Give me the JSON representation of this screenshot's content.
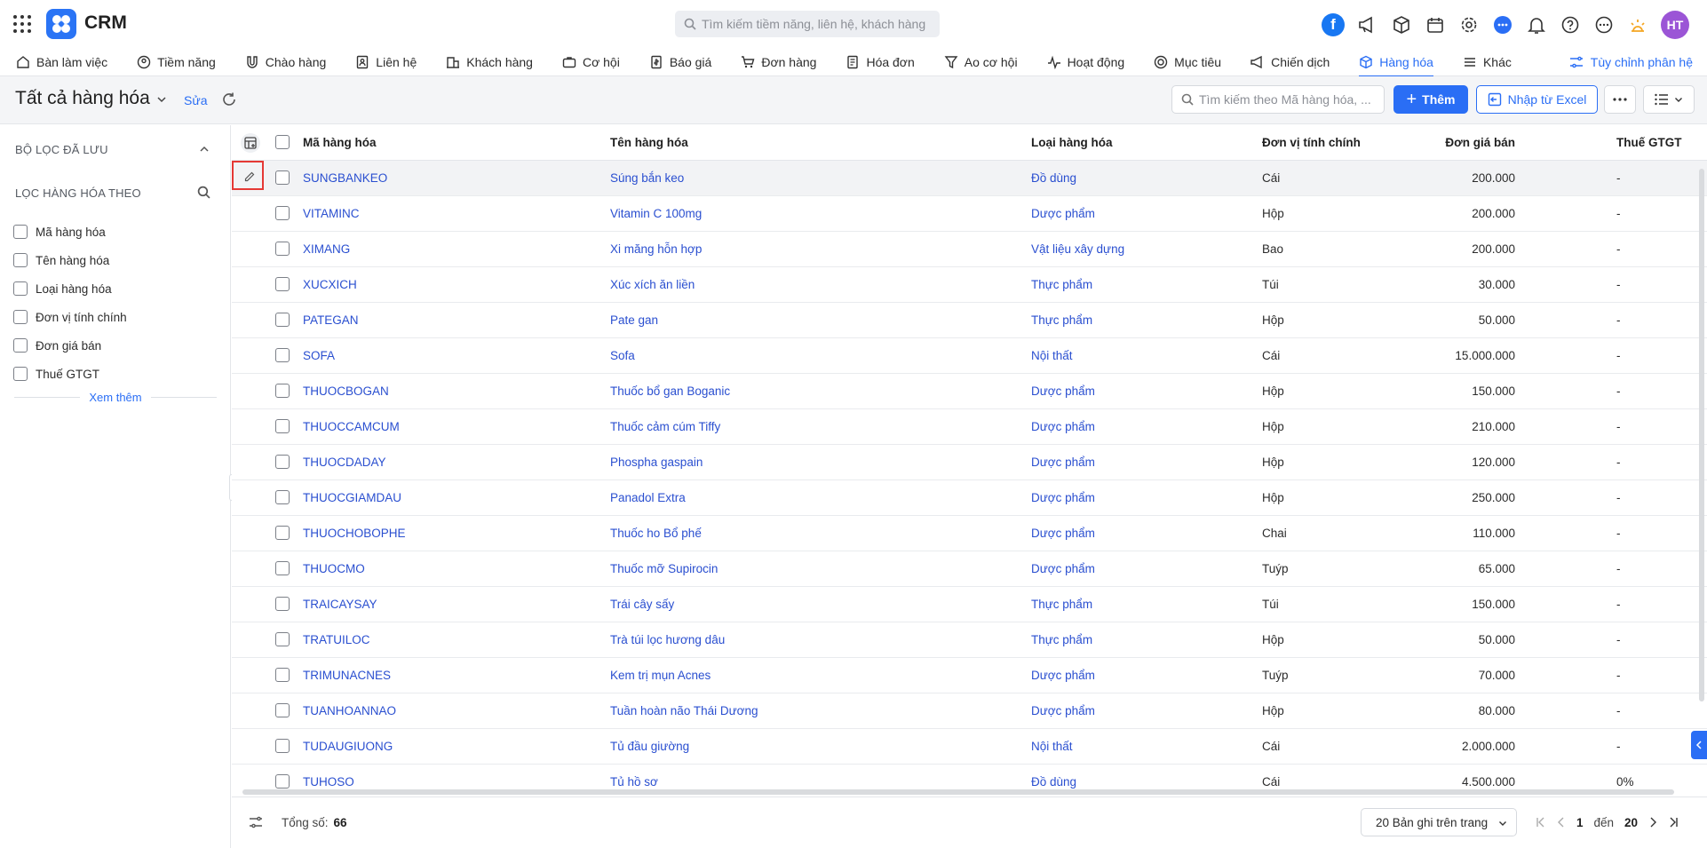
{
  "app": {
    "name": "CRM",
    "search_placeholder": "Tìm kiếm tiềm năng, liên hệ, khách hàng",
    "avatar_initials": "HT",
    "facebook_letter": "f"
  },
  "nav": {
    "items": [
      {
        "label": "Bàn làm việc",
        "icon": "home-icon"
      },
      {
        "label": "Tiềm năng",
        "icon": "user-circle-icon"
      },
      {
        "label": "Chào hàng",
        "icon": "magnet-icon"
      },
      {
        "label": "Liên hệ",
        "icon": "contact-icon"
      },
      {
        "label": "Khách hàng",
        "icon": "building-icon"
      },
      {
        "label": "Cơ hội",
        "icon": "briefcase-icon"
      },
      {
        "label": "Báo giá",
        "icon": "document-dollar-icon"
      },
      {
        "label": "Đơn hàng",
        "icon": "cart-icon"
      },
      {
        "label": "Hóa đơn",
        "icon": "invoice-icon"
      },
      {
        "label": "Ao cơ hội",
        "icon": "funnel-icon"
      },
      {
        "label": "Hoạt động",
        "icon": "pulse-icon"
      },
      {
        "label": "Mục tiêu",
        "icon": "target-icon"
      },
      {
        "label": "Chiến dịch",
        "icon": "megaphone-icon"
      },
      {
        "label": "Hàng hóa",
        "icon": "box-icon",
        "active": true
      },
      {
        "label": "Khác",
        "icon": "menu-icon"
      }
    ],
    "customize_label": "Tùy chỉnh phân hệ"
  },
  "toolbar": {
    "title": "Tất cả hàng hóa",
    "edit_label": "Sửa",
    "search_placeholder": "Tìm kiếm theo Mã hàng hóa, ...",
    "add_label": "Thêm",
    "import_label": "Nhập từ Excel"
  },
  "sidebar": {
    "saved_filters_title": "BỘ LỌC ĐÃ LƯU",
    "filter_by_title": "LỌC HÀNG HÓA THEO",
    "filters": [
      "Mã hàng hóa",
      "Tên hàng hóa",
      "Loại hàng hóa",
      "Đơn vị tính chính",
      "Đơn giá bán",
      "Thuế GTGT"
    ],
    "see_more": "Xem thêm"
  },
  "table": {
    "columns": [
      "Mã hàng hóa",
      "Tên hàng hóa",
      "Loại hàng hóa",
      "Đơn vị tính chính",
      "Đơn giá bán",
      "Thuế GTGT"
    ],
    "rows": [
      [
        "SUNGBANKEO",
        "Súng bắn keo",
        "Đồ dùng",
        "Cái",
        "200.000",
        "-"
      ],
      [
        "VITAMINC",
        "Vitamin C 100mg",
        "Dược phẩm",
        "Hộp",
        "200.000",
        "-"
      ],
      [
        "XIMANG",
        "Xi măng hỗn hợp",
        "Vật liệu xây dựng",
        "Bao",
        "200.000",
        "-"
      ],
      [
        "XUCXICH",
        "Xúc xích ăn liền",
        "Thực phẩm",
        "Túi",
        "30.000",
        "-"
      ],
      [
        "PATEGAN",
        "Pate gan",
        "Thực phẩm",
        "Hộp",
        "50.000",
        "-"
      ],
      [
        "SOFA",
        "Sofa",
        "Nội thất",
        "Cái",
        "15.000.000",
        "-"
      ],
      [
        "THUOCBOGAN",
        "Thuốc bổ gan Boganic",
        "Dược phẩm",
        "Hộp",
        "150.000",
        "-"
      ],
      [
        "THUOCCAMCUM",
        "Thuốc cảm cúm Tiffy",
        "Dược phẩm",
        "Hộp",
        "210.000",
        "-"
      ],
      [
        "THUOCDADAY",
        "Phospha gaspain",
        "Dược phẩm",
        "Hộp",
        "120.000",
        "-"
      ],
      [
        "THUOCGIAMDAU",
        "Panadol Extra",
        "Dược phẩm",
        "Hộp",
        "250.000",
        "-"
      ],
      [
        "THUOCHOBOPHE",
        "Thuốc ho Bổ phế",
        "Dược phẩm",
        "Chai",
        "110.000",
        "-"
      ],
      [
        "THUOCMO",
        "Thuốc mỡ Supirocin",
        "Dược phẩm",
        "Tuýp",
        "65.000",
        "-"
      ],
      [
        "TRAICAYSAY",
        "Trái cây sấy",
        "Thực phẩm",
        "Túi",
        "150.000",
        "-"
      ],
      [
        "TRATUILOC",
        "Trà túi lọc hương dâu",
        "Thực phẩm",
        "Hộp",
        "50.000",
        "-"
      ],
      [
        "TRIMUNACNES",
        "Kem trị mụn Acnes",
        "Dược phẩm",
        "Tuýp",
        "70.000",
        "-"
      ],
      [
        "TUANHOANNAO",
        "Tuần hoàn não Thái Dương",
        "Dược phẩm",
        "Hộp",
        "80.000",
        "-"
      ],
      [
        "TUDAUGIUONG",
        "Tủ đầu giường",
        "Nội thất",
        "Cái",
        "2.000.000",
        "-"
      ],
      [
        "TUHOSO",
        "Tủ hồ sơ",
        "Đồ dùng",
        "Cái",
        "4.500.000",
        "0%"
      ]
    ]
  },
  "footer": {
    "total_label": "Tổng số:",
    "total": "66",
    "page_size": "20 Bản ghi trên trang",
    "from": "1",
    "to_label": "đến",
    "to": "20"
  },
  "colors": {
    "accent": "#2a6ef5",
    "link": "#2a4fd0",
    "highlight": "#e53935",
    "avatar": "#9b55d6"
  }
}
